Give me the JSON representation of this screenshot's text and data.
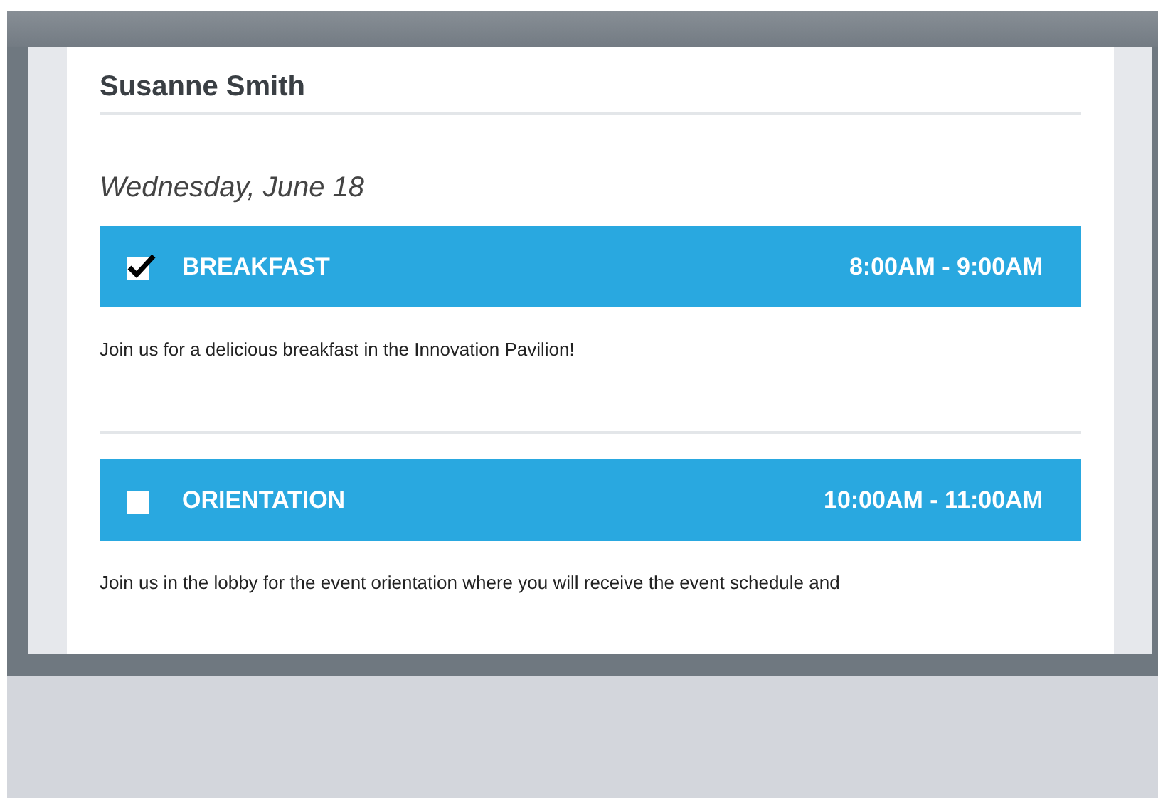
{
  "attendee": {
    "name": "Susanne Smith"
  },
  "day": {
    "label": "Wednesday, June 18"
  },
  "sessions": [
    {
      "title": "BREAKFAST",
      "time": "8:00AM - 9:00AM",
      "checked": true,
      "description": "Join us for a delicious breakfast in the Innovation Pavilion!"
    },
    {
      "title": "ORIENTATION",
      "time": "10:00AM - 11:00AM",
      "checked": false,
      "description": "Join us in the lobby for the event orientation where you will receive the event schedule and"
    }
  ]
}
